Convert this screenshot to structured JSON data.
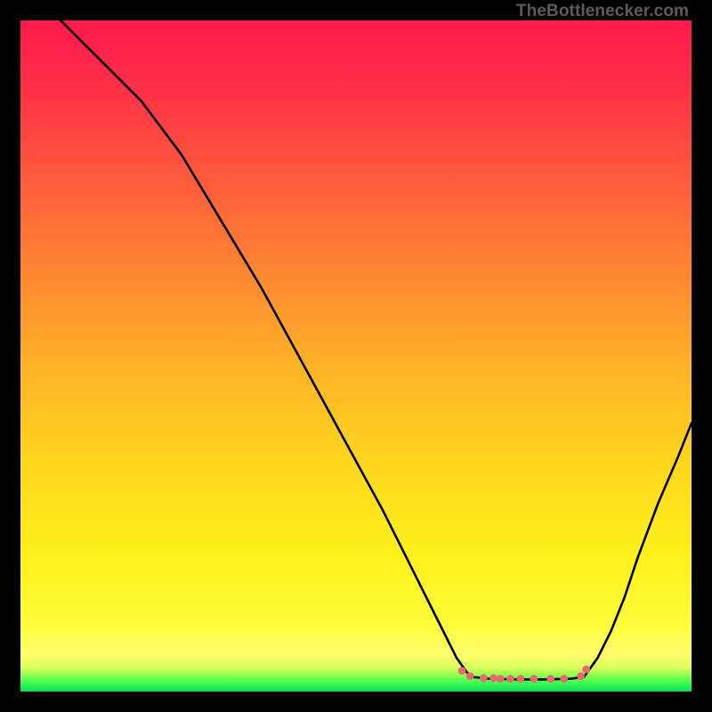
{
  "watermark": "TheBottlenecker.com",
  "chart_data": {
    "type": "line",
    "title": "",
    "xlabel": "",
    "ylabel": "",
    "xlim": [
      0,
      100
    ],
    "ylim": [
      0,
      100
    ],
    "gradient_stops": [
      {
        "offset": 0.0,
        "color": "#ff1a4b"
      },
      {
        "offset": 0.08,
        "color": "#ff2a49"
      },
      {
        "offset": 0.2,
        "color": "#ff4f3f"
      },
      {
        "offset": 0.35,
        "color": "#ff7e33"
      },
      {
        "offset": 0.5,
        "color": "#ffae28"
      },
      {
        "offset": 0.65,
        "color": "#ffd41e"
      },
      {
        "offset": 0.8,
        "color": "#fff21a"
      },
      {
        "offset": 0.9,
        "color": "#fffd3a"
      },
      {
        "offset": 0.945,
        "color": "#ffff6c"
      },
      {
        "offset": 0.965,
        "color": "#d8ff5a"
      },
      {
        "offset": 0.985,
        "color": "#4cff4c"
      },
      {
        "offset": 1.0,
        "color": "#00e05a"
      }
    ],
    "series": [
      {
        "name": "curve-left",
        "x": [
          6.0,
          10.0,
          14.0,
          18.0,
          24.0,
          30.0,
          36.0,
          42.0,
          48.0,
          54.0,
          60.0,
          63.0,
          65.0,
          67.0
        ],
        "y": [
          100.0,
          96.0,
          92.0,
          88.0,
          80.0,
          70.0,
          60.0,
          49.0,
          38.0,
          27.0,
          15.0,
          9.0,
          5.0,
          2.2
        ]
      },
      {
        "name": "flat-bottom",
        "x": [
          67.0,
          70.0,
          74.0,
          78.0,
          82.0,
          84.0
        ],
        "y": [
          2.2,
          1.9,
          1.8,
          1.8,
          1.9,
          2.2
        ]
      },
      {
        "name": "curve-right",
        "x": [
          84.0,
          86.0,
          88.0,
          90.0,
          92.0,
          95.0,
          98.0,
          100.0
        ],
        "y": [
          2.2,
          5.0,
          9.0,
          14.0,
          20.0,
          28.0,
          35.0,
          40.0
        ]
      }
    ],
    "markers": {
      "name": "bottom-markers",
      "color": "#e86a6a",
      "points": [
        {
          "x": 65.8,
          "y": 3.1
        },
        {
          "x": 67.0,
          "y": 2.3
        },
        {
          "x": 69.0,
          "y": 2.0
        },
        {
          "x": 70.5,
          "y": 2.0
        },
        {
          "x": 71.5,
          "y": 1.9
        },
        {
          "x": 73.0,
          "y": 1.9
        },
        {
          "x": 74.5,
          "y": 1.9
        },
        {
          "x": 76.5,
          "y": 1.9
        },
        {
          "x": 79.0,
          "y": 1.9
        },
        {
          "x": 81.0,
          "y": 1.9
        },
        {
          "x": 83.5,
          "y": 2.3
        },
        {
          "x": 84.3,
          "y": 3.3
        }
      ]
    }
  }
}
